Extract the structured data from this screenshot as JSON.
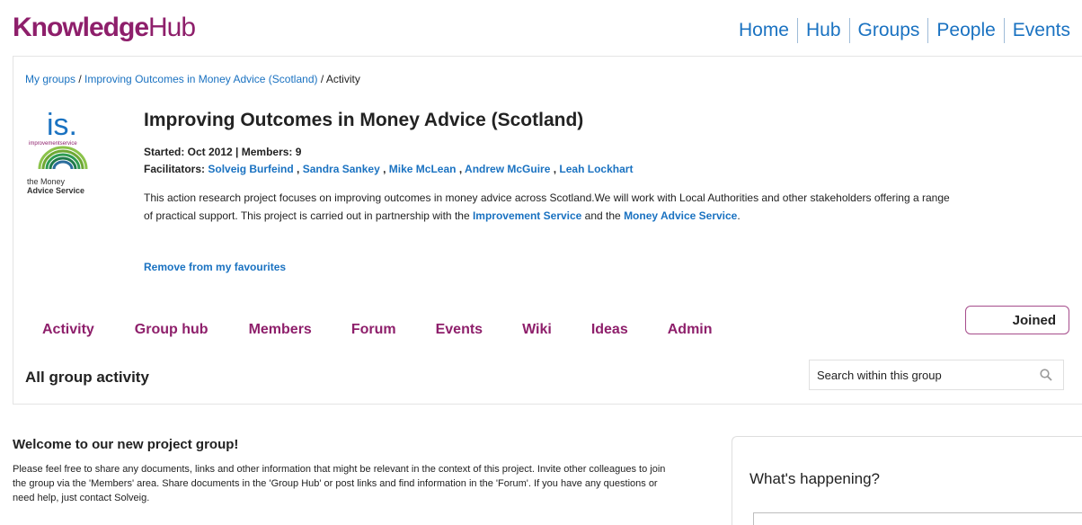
{
  "header": {
    "logo_bold": "Knowledge",
    "logo_light": "Hub",
    "nav": [
      "Home",
      "Hub",
      "Groups",
      "People",
      "Events"
    ]
  },
  "breadcrumb": {
    "my_groups": "My groups",
    "sep1": " / ",
    "group": "Improving Outcomes in Money Advice (Scotland)",
    "sep2": " / ",
    "current": "Activity"
  },
  "group": {
    "logo": {
      "brand_top": "is.",
      "brand_sub": "improvementservice",
      "brand_line1": "the Money",
      "brand_line2": "Advice Service"
    },
    "title": "Improving Outcomes in Money Advice (Scotland)",
    "meta": "Started: Oct 2012 | Members: 9",
    "facilitators_label": "Facilitators: ",
    "facilitators": [
      "Solveig Burfeind",
      "Sandra Sankey",
      "Mike McLean",
      "Andrew McGuire",
      "Leah Lockhart"
    ],
    "desc_part1": "This action research project  focuses on improving outcomes in money advice across Scotland.We will work with Local Authorities and other stakeholders offering a range of practical support. This project is carried out in partnership with the ",
    "desc_link1": "Improvement Service",
    "desc_part2": " and the ",
    "desc_link2": "Money Advice Service",
    "desc_part3": ".",
    "favourite_link": "Remove from my favourites"
  },
  "tabs": [
    "Activity",
    "Group hub",
    "Members",
    "Forum",
    "Events",
    "Wiki",
    "Ideas",
    "Admin"
  ],
  "joined_label": "Joined",
  "activity": {
    "title": "All group activity",
    "search_placeholder": "Search within this group"
  },
  "welcome": {
    "title": "Welcome to our new project group!",
    "text": "Please feel free to share any documents, links and other information that might be relevant in the context of this project. Invite other colleagues to join the group via the 'Members' area. Share documents in the 'Group Hub' or post links and find information in the 'Forum'. If you have any questions or need help, just contact Solveig."
  },
  "sidebar": {
    "title": "What's happening?"
  },
  "colors": {
    "brand": "#8e1f6b",
    "link": "#1a72c1"
  }
}
